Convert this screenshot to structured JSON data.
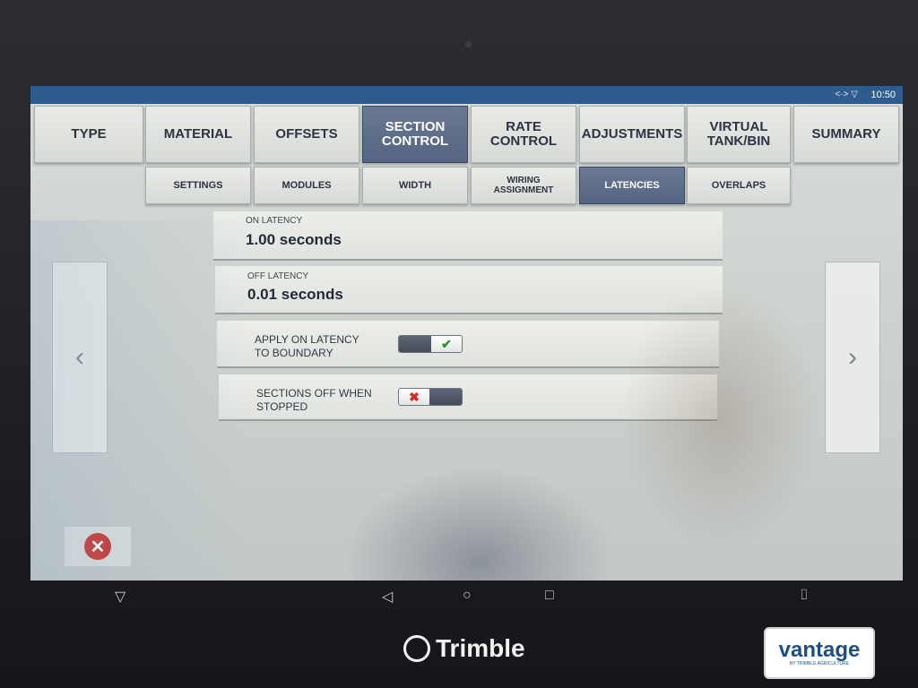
{
  "status_bar": {
    "icons": "<·> ▽",
    "time": "10:50"
  },
  "main_tabs": [
    {
      "label": "TYPE",
      "active": false
    },
    {
      "label": "MATERIAL",
      "active": false
    },
    {
      "label": "OFFSETS",
      "active": false
    },
    {
      "label": "SECTION\nCONTROL",
      "active": true
    },
    {
      "label": "RATE\nCONTROL",
      "active": false
    },
    {
      "label": "ADJUSTMENTS",
      "active": false
    },
    {
      "label": "VIRTUAL\nTANK/BIN",
      "active": false
    },
    {
      "label": "SUMMARY",
      "active": false
    }
  ],
  "sub_tabs": [
    {
      "label": "SETTINGS",
      "active": false
    },
    {
      "label": "MODULES",
      "active": false
    },
    {
      "label": "WIDTH",
      "active": false
    },
    {
      "label": "WIRING\nASSIGNMENT",
      "active": false
    },
    {
      "label": "LATENCIES",
      "active": true
    },
    {
      "label": "OVERLAPS",
      "active": false
    }
  ],
  "latencies": {
    "on_latency": {
      "label": "ON LATENCY",
      "value": "1.00  seconds"
    },
    "off_latency": {
      "label": "OFF LATENCY",
      "value": "0.01  seconds"
    },
    "apply_on_latency": {
      "label": "APPLY ON LATENCY\nTO BOUNDARY",
      "state": "on",
      "glyph": "✔"
    },
    "sections_off_stopped": {
      "label": "SECTIONS OFF WHEN\nSTOPPED",
      "state": "off",
      "glyph": "✖"
    }
  },
  "navigation": {
    "prev": "‹",
    "next": "›"
  },
  "cancel": {
    "glyph": "✕",
    "color": "#c9332f"
  },
  "android_nav": {
    "back": "◁",
    "home": "○",
    "recents": "□",
    "camera": "⌷"
  },
  "branding": {
    "device": "Trimble",
    "dealer": "vantage",
    "dealer_sub": "BY TRIMBLE AGRICULTURE"
  },
  "colors": {
    "status_bar": "#2f5c8f",
    "active_tab": "#546482",
    "check": "#2f8d2f",
    "cross": "#d42a2a"
  }
}
